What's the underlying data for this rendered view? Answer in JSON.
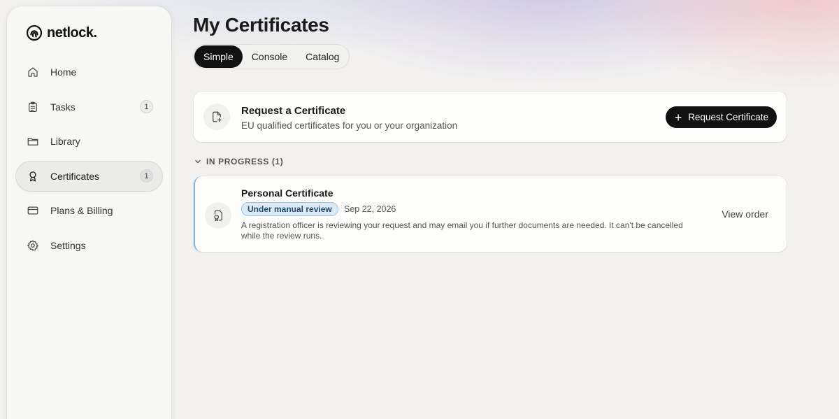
{
  "app": {
    "logo_text": "netlock",
    "logo_dot": "."
  },
  "sidebar": {
    "items": [
      {
        "label": "Home",
        "icon": "home-icon",
        "badge": null
      },
      {
        "label": "Tasks",
        "icon": "clipboard-icon",
        "badge": "1"
      },
      {
        "label": "Library",
        "icon": "folder-icon",
        "badge": null
      },
      {
        "label": "Certificates",
        "icon": "award-ribbon-icon",
        "badge": "1",
        "active": true
      },
      {
        "label": "Plans & Billing",
        "icon": "credit-card-icon",
        "badge": null
      },
      {
        "label": "Settings",
        "icon": "gear-icon",
        "badge": null
      }
    ]
  },
  "header": {
    "title": "My Certificates",
    "tabs": [
      {
        "label": "Simple",
        "active": true
      },
      {
        "label": "Console",
        "active": false
      },
      {
        "label": "Catalog",
        "active": false
      }
    ]
  },
  "request_card": {
    "title": "Request a Certificate",
    "subtitle": "EU qualified certificates for you or your organization",
    "button_label": "Request Certificate",
    "button_icon": "plus-icon"
  },
  "in_progress": {
    "header": "IN PROGRESS (1)",
    "items": [
      {
        "title": "Personal Certificate",
        "status": "Under manual review",
        "date": "Sep 22, 2026",
        "description": "A registration officer is reviewing your request and may email you if further documents are needed. It can't be cancelled while the review runs.",
        "action_label": "View order",
        "icon": "certificate-seal-icon"
      }
    ]
  },
  "colors": {
    "accent_dark": "#111111",
    "status_bg": "#dceaf7",
    "status_border": "#9cc3e6",
    "progress_border": "#7fb4e3",
    "background": "#f2f1f0"
  }
}
